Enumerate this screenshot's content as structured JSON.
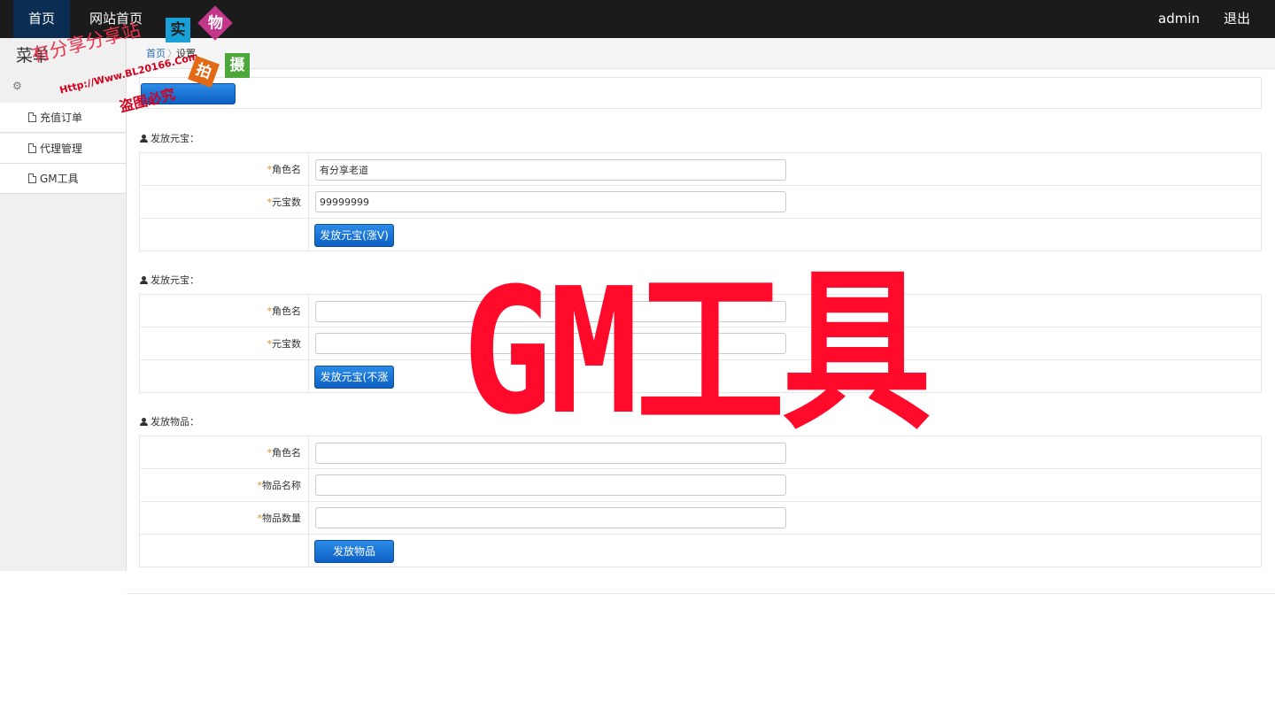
{
  "nav": {
    "home": "首页",
    "site_home": "网站首页",
    "user": "admin",
    "logout": "退出"
  },
  "sidebar": {
    "title": "菜单",
    "items": [
      {
        "label": "充值订单"
      },
      {
        "label": "代理管理"
      },
      {
        "label": "GM工具"
      }
    ]
  },
  "breadcrumb": {
    "home": "首页",
    "current": "设置"
  },
  "sections": [
    {
      "title": "发放元宝：",
      "fields": [
        {
          "label": "角色名",
          "value": "有分享老道"
        },
        {
          "label": "元宝数",
          "value": "99999999"
        }
      ],
      "button": "发放元宝(涨V)"
    },
    {
      "title": "发放元宝：",
      "fields": [
        {
          "label": "角色名",
          "value": ""
        },
        {
          "label": "元宝数",
          "value": ""
        }
      ],
      "button": "发放元宝(不涨V)"
    },
    {
      "title": "发放物品：",
      "fields": [
        {
          "label": "角色名",
          "value": ""
        },
        {
          "label": "物品名称",
          "value": ""
        },
        {
          "label": "物品数量",
          "value": ""
        }
      ],
      "button": "发放物品"
    }
  ],
  "required_mark": "*",
  "watermark": {
    "big": "GM工具",
    "site": "有分享分享站",
    "url": "Http://Www.BL20166.Com",
    "warning": "盗图必究",
    "badges": [
      "实",
      "物",
      "拍",
      "摄"
    ]
  },
  "colors": {
    "navbar": "#1b1b1b",
    "nav_active": "#0b2d54",
    "button_blue": "#0d5fc4",
    "required_star": "#e38a1c",
    "watermark_red": "#ff0a2a"
  }
}
